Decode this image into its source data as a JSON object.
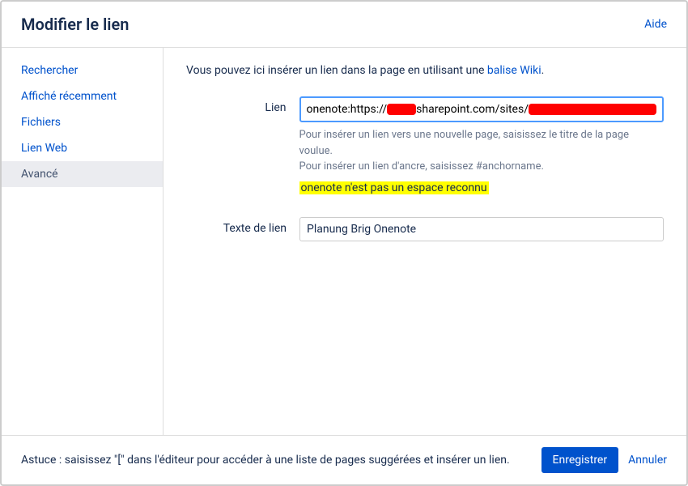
{
  "header": {
    "title": "Modifier le lien",
    "help": "Aide"
  },
  "sidebar": {
    "items": [
      {
        "label": "Rechercher",
        "active": false
      },
      {
        "label": "Affiché récemment",
        "active": false
      },
      {
        "label": "Fichiers",
        "active": false
      },
      {
        "label": "Lien Web",
        "active": false
      },
      {
        "label": "Avancé",
        "active": true
      }
    ]
  },
  "main": {
    "intro_prefix": "Vous pouvez ici insérer un lien dans la page en utilisant une ",
    "intro_link": "balise Wiki",
    "intro_suffix": ".",
    "link_label": "Lien",
    "link_value_prefix": "onenote:https://",
    "link_value_mid": "sharepoint.com/sites/",
    "hint_line1": "Pour insérer un lien vers une nouvelle page, saisissez le titre de la page voulue.",
    "hint_line2": "Pour insérer un lien d'ancre, saisissez #anchorname.",
    "error": "onenote n'est pas un espace reconnu",
    "text_label": "Texte de lien",
    "text_value": "Planung Brig Onenote"
  },
  "footer": {
    "tip": "Astuce : saisissez \"[\" dans l'éditeur pour accéder à une liste de pages suggérées et insérer un lien.",
    "save": "Enregistrer",
    "cancel": "Annuler"
  }
}
